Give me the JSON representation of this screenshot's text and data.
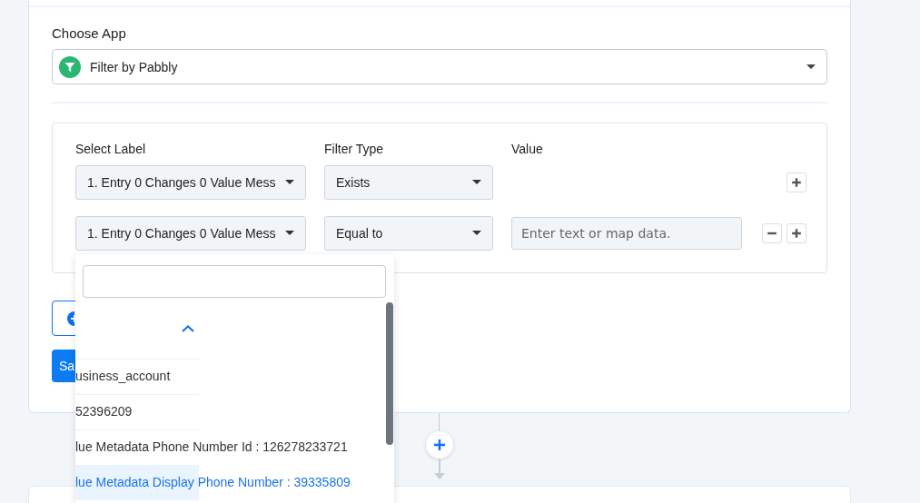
{
  "app_section": {
    "label": "Choose App",
    "selected_app": "Filter by Pabbly"
  },
  "filter": {
    "columns": [
      "Select Label",
      "Filter Type",
      "Value"
    ],
    "rows": [
      {
        "label_value": "1. Entry 0 Changes 0 Value Mess",
        "filter_type": "Exists",
        "removable": false
      },
      {
        "label_value": "1. Entry 0 Changes 0 Value Mess",
        "filter_type": "Equal to",
        "value_placeholder": "Enter text or map data.",
        "removable": true
      }
    ]
  },
  "save_button": "Sa",
  "dropdown": {
    "items": [
      {
        "text": "usiness_account",
        "selected": false
      },
      {
        "text": "52396209",
        "selected": false
      },
      {
        "text": "lue Metadata Phone Number Id : 126278233721",
        "selected": false
      },
      {
        "text": "lue Metadata Display Phone Number : 39335809",
        "selected": true
      }
    ]
  }
}
